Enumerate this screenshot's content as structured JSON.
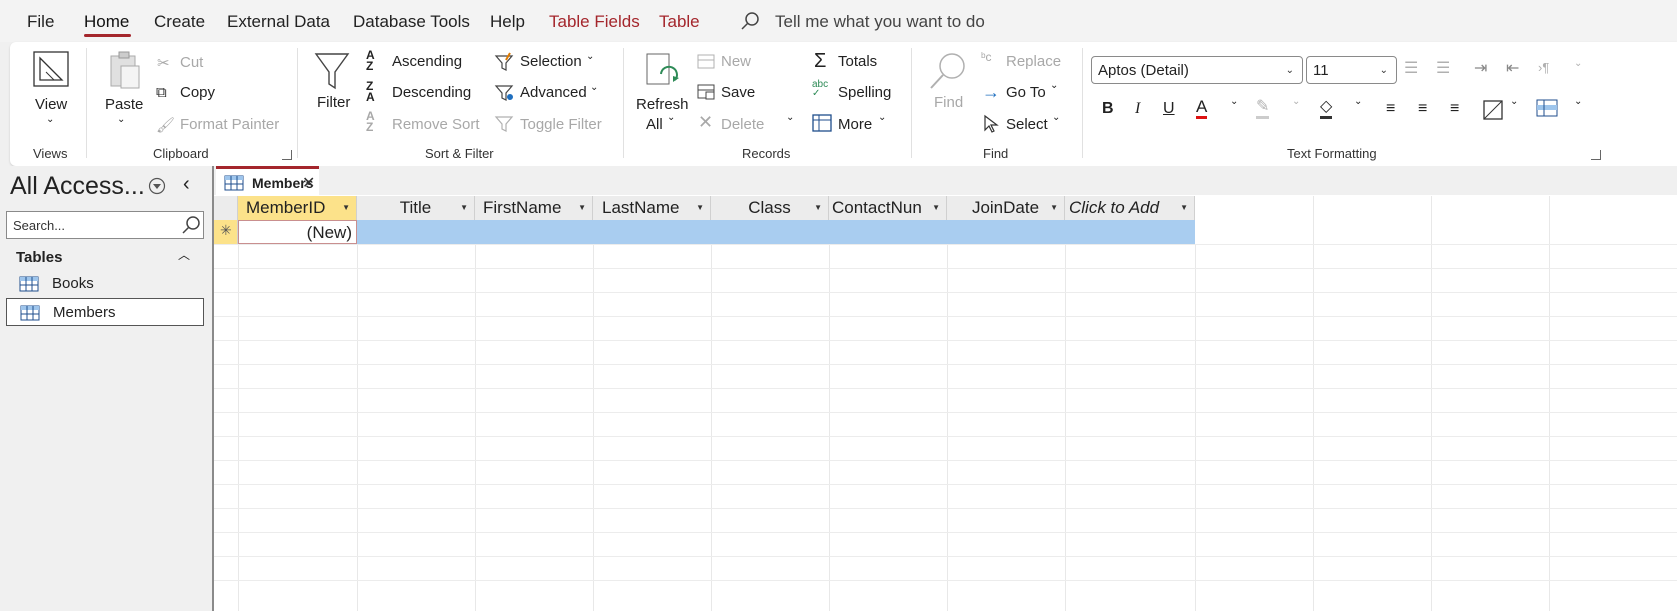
{
  "menu": {
    "tabs": [
      "File",
      "Home",
      "Create",
      "External Data",
      "Database Tools",
      "Help",
      "Table Fields",
      "Table"
    ],
    "tell_me": "Tell me what you want to do"
  },
  "ribbon": {
    "views": {
      "view": "View",
      "group": "Views"
    },
    "clipboard": {
      "paste": "Paste",
      "cut": "Cut",
      "copy": "Copy",
      "format_painter": "Format Painter",
      "group": "Clipboard"
    },
    "sort_filter": {
      "filter": "Filter",
      "ascending": "Ascending",
      "descending": "Descending",
      "remove_sort": "Remove Sort",
      "selection": "Selection",
      "advanced": "Advanced",
      "toggle_filter": "Toggle Filter",
      "group": "Sort & Filter"
    },
    "records": {
      "refresh": "Refresh",
      "all": "All",
      "new": "New",
      "save": "Save",
      "delete": "Delete",
      "totals": "Totals",
      "spelling": "Spelling",
      "more": "More",
      "group": "Records"
    },
    "find": {
      "find": "Find",
      "replace": "Replace",
      "goto": "Go To",
      "select": "Select",
      "group": "Find"
    },
    "text_formatting": {
      "font": "Aptos (Detail)",
      "size": "11",
      "group": "Text Formatting"
    }
  },
  "nav": {
    "title": "All Access...",
    "search_placeholder": "Search...",
    "section": "Tables",
    "items": [
      {
        "label": "Books"
      },
      {
        "label": "Members"
      }
    ]
  },
  "doc": {
    "tab": "Members",
    "columns": [
      "MemberID",
      "Title",
      "FirstName",
      "LastName",
      "Class",
      "ContactNun",
      "JoinDate",
      "Click to Add"
    ],
    "new_row": "(New)"
  },
  "colors": {
    "accent": "#a4262c",
    "selected_header": "#fce28a",
    "new_row": "#a9cdf0"
  }
}
